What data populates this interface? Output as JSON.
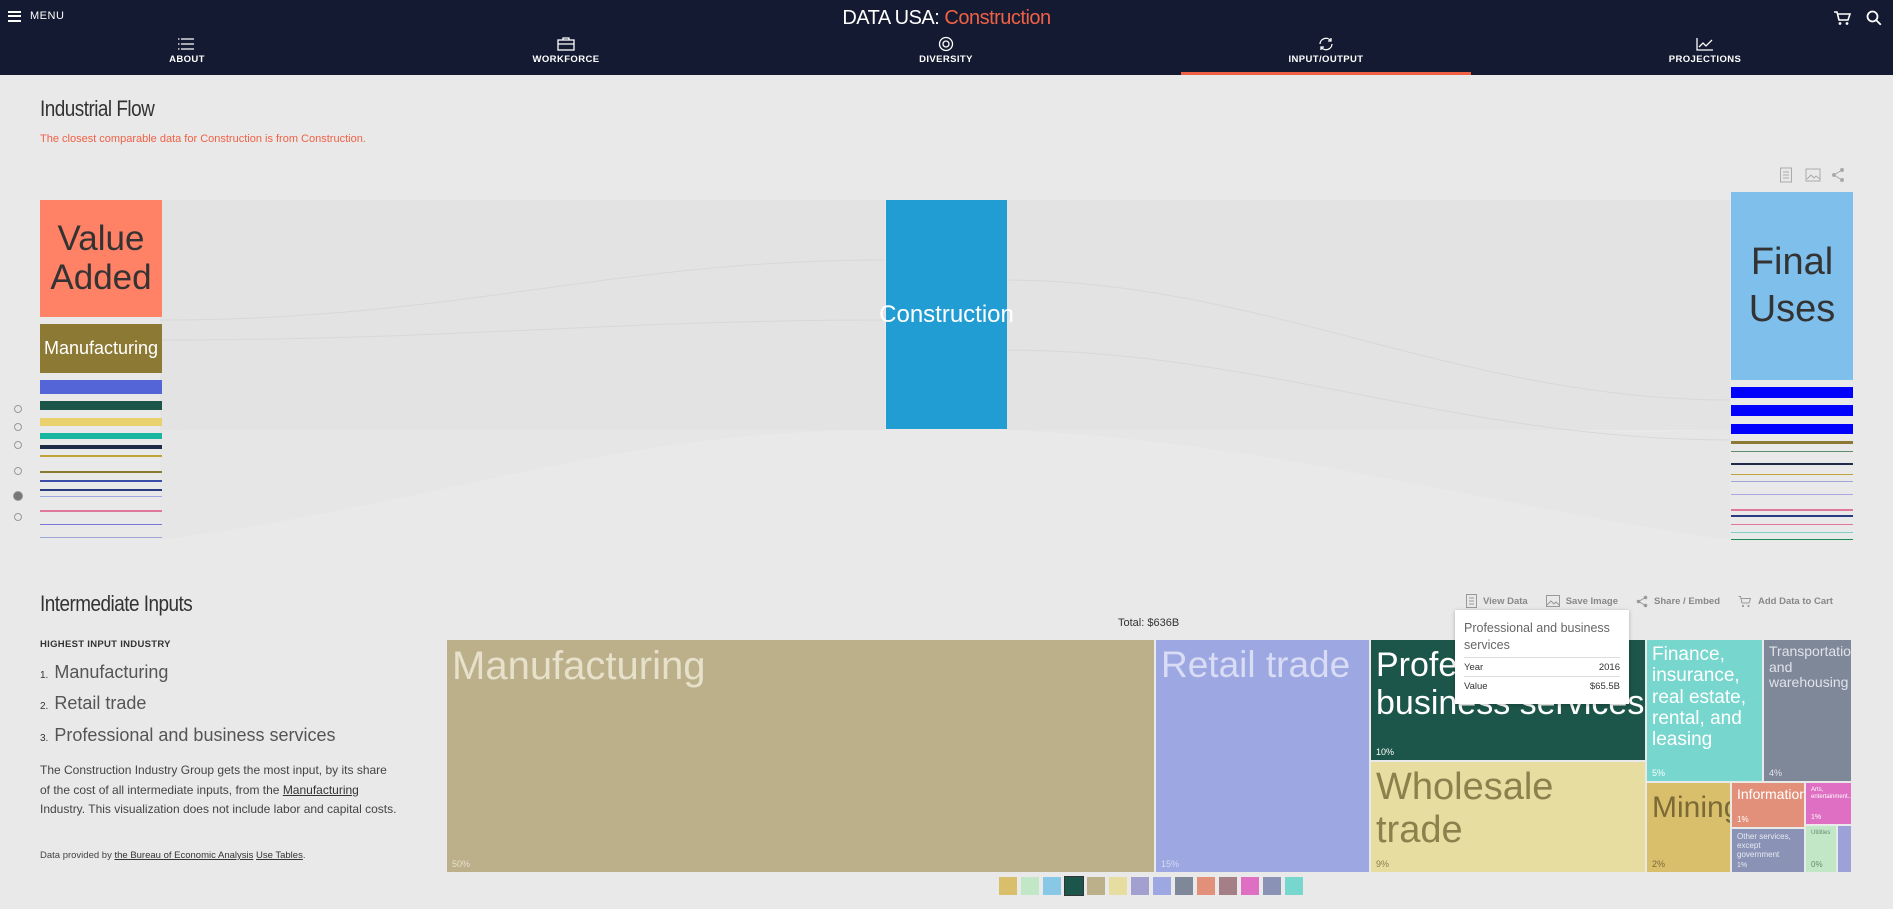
{
  "nav": {
    "menu_label": "MENU",
    "brand": "DATA USA:",
    "title": "Construction",
    "tabs": [
      {
        "label": "ABOUT"
      },
      {
        "label": "WORKFORCE"
      },
      {
        "label": "DIVERSITY"
      },
      {
        "label": "INPUT/OUTPUT"
      },
      {
        "label": "PROJECTIONS"
      }
    ],
    "active_tab": "INPUT/OUTPUT"
  },
  "flow_section": {
    "heading": "Industrial Flow",
    "note": "The closest comparable data for Construction is from Construction.",
    "left_nodes": [
      {
        "label": "Value Added",
        "color": "#ff8166"
      },
      {
        "label": "Manufacturing",
        "color": "#8c7a34"
      }
    ],
    "center_node": {
      "label": "Construction",
      "color": "#229dd4"
    },
    "right_node": {
      "label": "Final Uses",
      "color": "#7fbfec"
    }
  },
  "inputs_section": {
    "heading": "Intermediate Inputs",
    "highest_label": "HIGHEST INPUT INDUSTRY",
    "ranking": [
      "Manufacturing",
      "Retail trade",
      "Professional and business services"
    ],
    "description_pre": "The Construction Industry Group gets the most input, by its share of the cost of all intermediate inputs, from the",
    "description_link": "Manufacturing",
    "description_post": "Industry. This visualization does not include labor and capital costs.",
    "source_pre": "Data provided by",
    "source_link1": "the Bureau of Economic Analysis",
    "source_link2": "Use Tables",
    "source_post": "."
  },
  "toolbar": {
    "view_data": "View Data",
    "save_image": "Save Image",
    "share_embed": "Share / Embed",
    "add_to_cart": "Add Data to Cart"
  },
  "chart_data": {
    "type": "treemap",
    "total_label": "Total: $636B",
    "tiles": [
      {
        "name": "Manufacturing",
        "pct": "50%",
        "color": "#bbb08a"
      },
      {
        "name": "Retail trade",
        "pct": "15%",
        "color": "#9da7e1"
      },
      {
        "name": "Professional and business services",
        "pct": "10%",
        "color": "#1c5549"
      },
      {
        "name": "Wholesale trade",
        "pct": "9%",
        "color": "#e7dda1"
      },
      {
        "name": "Finance, insurance, real estate, rental, and leasing",
        "pct": "5%",
        "color": "#77d6cd"
      },
      {
        "name": "Transportation and warehousing",
        "pct": "4%",
        "color": "#7f8899"
      },
      {
        "name": "Mining",
        "pct": "2%",
        "color": "#d9be6c"
      },
      {
        "name": "Information",
        "pct": "1%",
        "color": "#e2907a"
      },
      {
        "name": "Arts, entertainment...",
        "pct": "1%",
        "color": "#de6fc2"
      },
      {
        "name": "Other services, except government",
        "pct": "1%",
        "color": "#8a93b5"
      },
      {
        "name": "Utilities",
        "pct": "0%",
        "color": "#c2e7c7"
      },
      {
        "name": "",
        "pct": "",
        "color": "#9ca1d8"
      }
    ],
    "tooltip": {
      "title": "Professional and business services",
      "year_label": "Year",
      "year": "2016",
      "value_label": "Value",
      "value": "$65.5B"
    },
    "legend_colors": [
      "#d9be6c",
      "#c2e7c7",
      "#88c8e6",
      "#1c5549",
      "#bbb08a",
      "#e7dda1",
      "#a3a0cf",
      "#9da7e1",
      "#7f8899",
      "#e2907a",
      "#a57f88",
      "#de6fc2",
      "#8a93b5",
      "#77d6cd"
    ]
  }
}
